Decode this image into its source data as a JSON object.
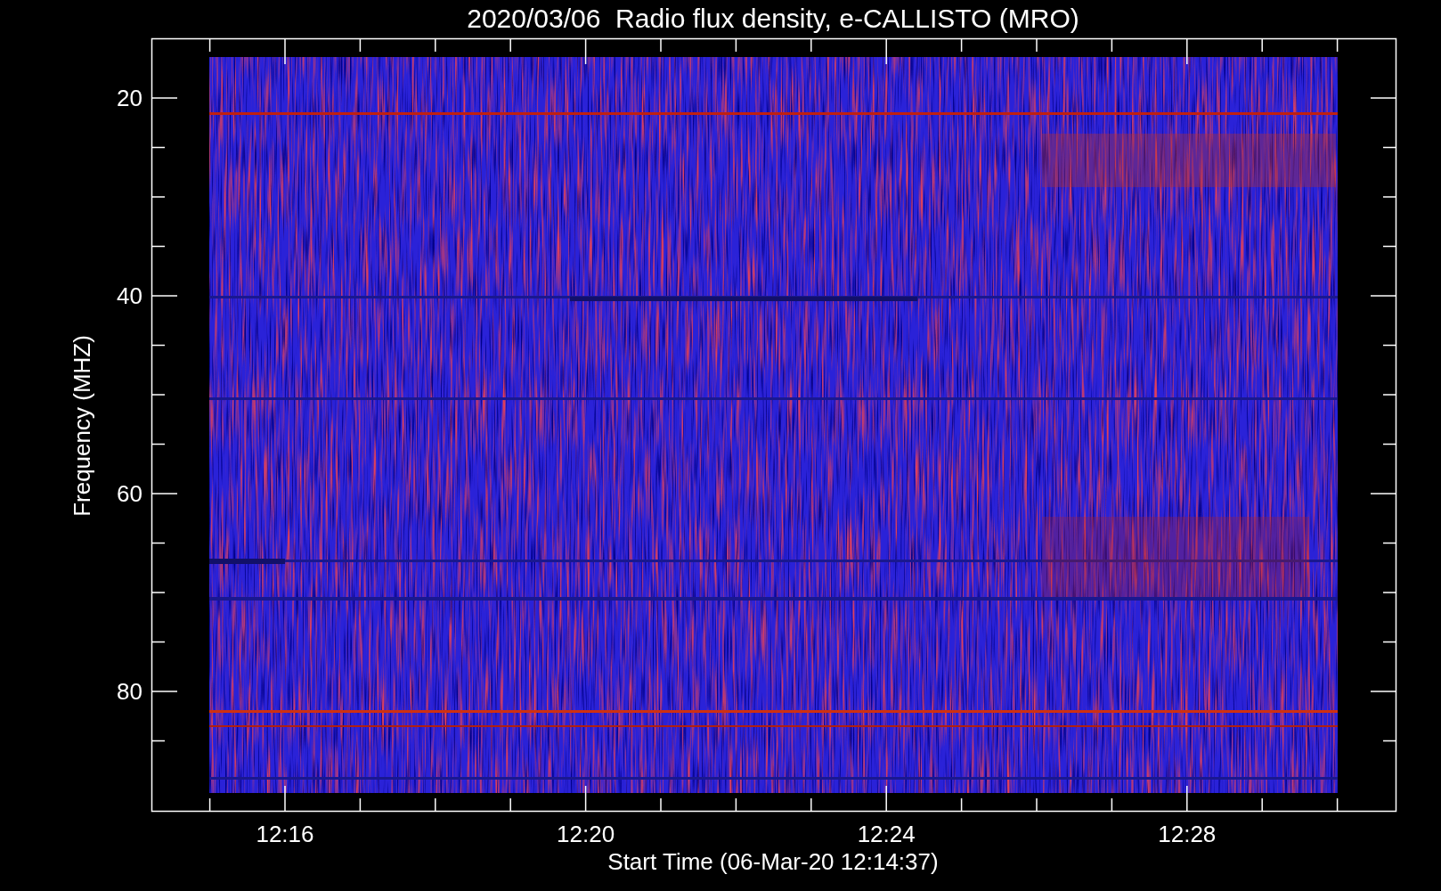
{
  "title": "2020/03/06  Radio flux density, e-CALLISTO (MRO)",
  "y_axis": {
    "label": "Frequency (MHZ)",
    "tick_labels": [
      "20",
      "40",
      "60",
      "80"
    ]
  },
  "x_axis": {
    "label": "Start Time (06-Mar-20 12:14:37)",
    "tick_labels": [
      "12:16",
      "12:20",
      "12:24",
      "12:28"
    ]
  }
}
